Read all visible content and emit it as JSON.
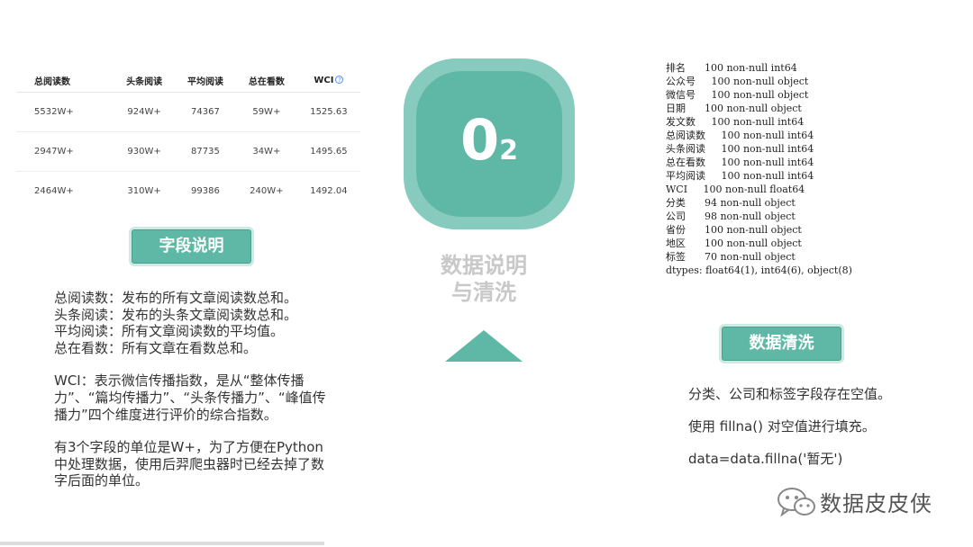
{
  "table": {
    "headers": [
      "总阅读数",
      "头条阅读",
      "平均阅读",
      "总在看数",
      "WCI"
    ],
    "rows": [
      [
        "5532W+",
        "924W+",
        "74367",
        "59W+",
        "1525.63"
      ],
      [
        "2947W+",
        "930W+",
        "87735",
        "34W+",
        "1495.65"
      ],
      [
        "2464W+",
        "310W+",
        "99386",
        "240W+",
        "1492.04"
      ]
    ],
    "help_icon_glyph": "?"
  },
  "left_section": {
    "title": "字段说明",
    "lines": [
      "总阅读数：发布的所有文章阅读数总和。",
      "头条阅读：发布的头条文章阅读数总和。",
      "平均阅读：所有文章阅读数的平均值。",
      "总在看数：所有文章在看数总和。"
    ],
    "wci_text": "WCI：表示微信传播指数，是从“整体传播力”、“篇均传播力”、“头条传播力”、“峰值传播力”四个维度进行评价的综合指数。",
    "unit_text": "有3个字段的单位是W+，为了方便在Python中处理数据，使用后羿爬虫器时已经去掉了数字后面的单位。"
  },
  "center": {
    "number_main": "0",
    "number_sub": "2",
    "title_line1": "数据说明",
    "title_line2": "与清洗"
  },
  "info_lines": [
    "排名      100 non-null int64",
    "公众号     100 non-null object",
    "微信号     100 non-null object",
    "日期      100 non-null object",
    "发文数     100 non-null int64",
    "总阅读数     100 non-null int64",
    "头条阅读     100 non-null int64",
    "总在看数     100 non-null int64",
    "平均阅读     100 non-null int64",
    "WCI     100 non-null float64",
    "分类      94 non-null object",
    "公司      98 non-null object",
    "省份      100 non-null object",
    "地区      100 non-null object",
    "标签      70 non-null object",
    "dtypes: float64(1), int64(6), object(8)"
  ],
  "right_section": {
    "title": "数据清洗",
    "lines": [
      "分类、公司和标签字段存在空值。",
      "使用  fillna() 对空值进行填充。",
      "data=data.fillna('暂无')"
    ]
  },
  "watermark": {
    "text": "数据皮皮侠",
    "icon": "wechat-icon"
  },
  "colors": {
    "accent": "#5fb8a6",
    "accent_light": "#86cbbd",
    "title_gray": "#c8c8c8"
  }
}
